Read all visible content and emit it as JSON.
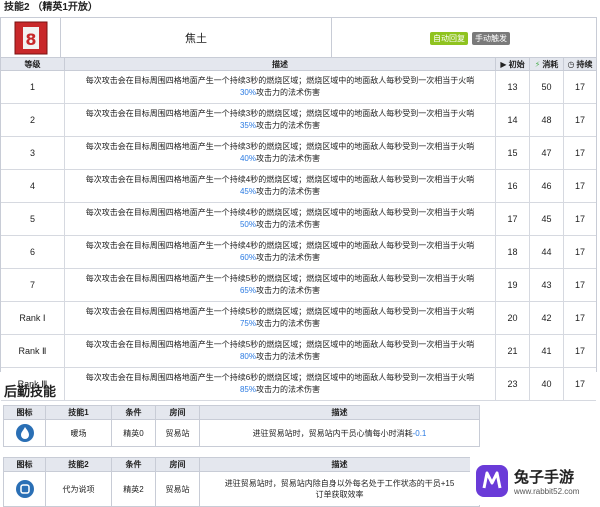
{
  "header": {
    "title": "技能2 （精英1开放）"
  },
  "skill": {
    "name": "焦土",
    "badge_recovery": "自动回复",
    "badge_trigger": "手动触发"
  },
  "table_headers": {
    "level": "等级",
    "desc": "描述",
    "initial": "初始",
    "cost": "消耗",
    "duration": "持续"
  },
  "levels": [
    {
      "level": "1",
      "line1": "每次攻击会在目标周围四格地面产生一个持续3秒的燃烧区域；燃烧区域中的地面敌人每秒受到一次相当于火哨",
      "pct": "30%",
      "line2": "攻击力的法术伤害",
      "initial": "13",
      "cost": "50",
      "duration": "17"
    },
    {
      "level": "2",
      "line1": "每次攻击会在目标周围四格地面产生一个持续3秒的燃烧区域；燃烧区域中的地面敌人每秒受到一次相当于火哨",
      "pct": "35%",
      "line2": "攻击力的法术伤害",
      "initial": "14",
      "cost": "48",
      "duration": "17"
    },
    {
      "level": "3",
      "line1": "每次攻击会在目标周围四格地面产生一个持续3秒的燃烧区域；燃烧区域中的地面敌人每秒受到一次相当于火哨",
      "pct": "40%",
      "line2": "攻击力的法术伤害",
      "initial": "15",
      "cost": "47",
      "duration": "17"
    },
    {
      "level": "4",
      "line1": "每次攻击会在目标周围四格地面产生一个持续4秒的燃烧区域；燃烧区域中的地面敌人每秒受到一次相当于火哨",
      "pct": "45%",
      "line2": "攻击力的法术伤害",
      "initial": "16",
      "cost": "46",
      "duration": "17"
    },
    {
      "level": "5",
      "line1": "每次攻击会在目标周围四格地面产生一个持续4秒的燃烧区域；燃烧区域中的地面敌人每秒受到一次相当于火哨",
      "pct": "50%",
      "line2": "攻击力的法术伤害",
      "initial": "17",
      "cost": "45",
      "duration": "17"
    },
    {
      "level": "6",
      "line1": "每次攻击会在目标周围四格地面产生一个持续4秒的燃烧区域；燃烧区域中的地面敌人每秒受到一次相当于火哨",
      "pct": "60%",
      "line2": "攻击力的法术伤害",
      "initial": "18",
      "cost": "44",
      "duration": "17"
    },
    {
      "level": "7",
      "line1": "每次攻击会在目标周围四格地面产生一个持续5秒的燃烧区域；燃烧区域中的地面敌人每秒受到一次相当于火哨",
      "pct": "65%",
      "line2": "攻击力的法术伤害",
      "initial": "19",
      "cost": "43",
      "duration": "17"
    },
    {
      "level": "Rank Ⅰ",
      "line1": "每次攻击会在目标周围四格地面产生一个持续5秒的燃烧区域；燃烧区域中的地面敌人每秒受到一次相当于火哨",
      "pct": "75%",
      "line2": "攻击力的法术伤害",
      "initial": "20",
      "cost": "42",
      "duration": "17"
    },
    {
      "level": "Rank Ⅱ",
      "line1": "每次攻击会在目标周围四格地面产生一个持续5秒的燃烧区域；燃烧区域中的地面敌人每秒受到一次相当于火哨",
      "pct": "80%",
      "line2": "攻击力的法术伤害",
      "initial": "21",
      "cost": "41",
      "duration": "17"
    },
    {
      "level": "Rank Ⅲ",
      "line1": "每次攻击会在目标周围四格地面产生一个持续6秒的燃烧区域；燃烧区域中的地面敌人每秒受到一次相当于火哨",
      "pct": "85%",
      "line2": "攻击力的法术伤害",
      "initial": "23",
      "cost": "40",
      "duration": "17"
    }
  ],
  "logistics": {
    "title": "后勤技能",
    "headers": {
      "icon": "图标",
      "skill1": "技能1",
      "skill2": "技能2",
      "cond": "条件",
      "room": "房间",
      "desc": "描述"
    },
    "skills": [
      {
        "name": "暖场",
        "cond": "精英0",
        "room": "贸易站",
        "desc": "进驻贸易站时，贸易站内干员心情每小时消耗",
        "val": "-0.1"
      },
      {
        "name": "代为说项",
        "cond": "精英2",
        "room": "贸易站",
        "desc": "进驻贸易站时，贸易站内除自身以外每名处于工作状态的干员+15",
        "desc2": "订单获取效率"
      }
    ]
  },
  "watermark": {
    "title": "兔子手游",
    "url": "www.rabbit52.com"
  }
}
